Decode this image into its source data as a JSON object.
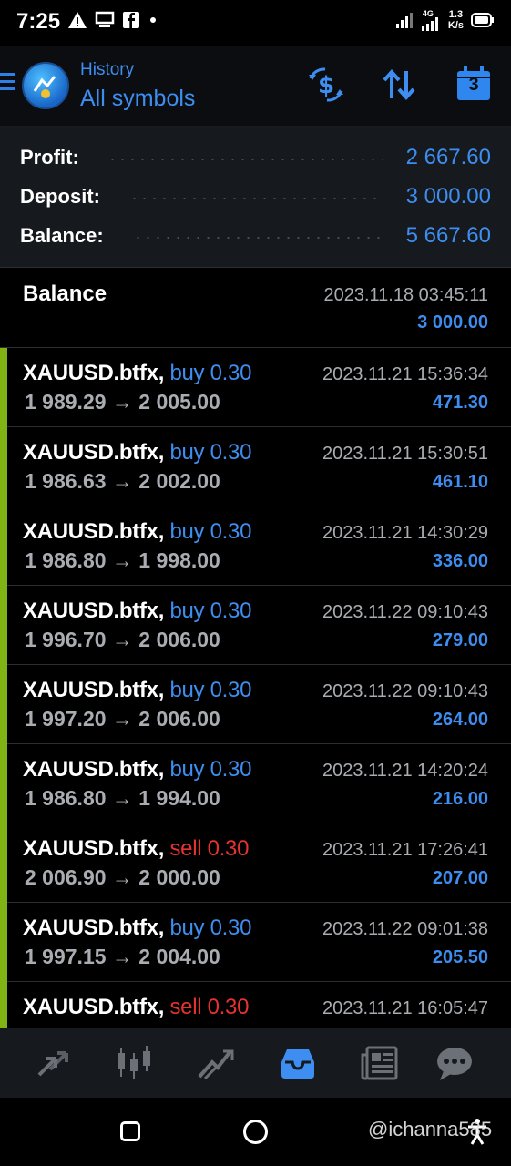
{
  "status_bar": {
    "time": "7:25",
    "network": "4G",
    "speed_value": "1.3",
    "speed_unit": "K/s",
    "icons": [
      "warning-icon",
      "device-icon",
      "facebook-icon",
      "dot-icon",
      "signal-icon",
      "signal-icon-2",
      "battery-icon"
    ]
  },
  "toolbar": {
    "subtitle": "History",
    "title": "All symbols",
    "calendar_day": "3",
    "icons": [
      "menu-icon",
      "dollar-swap-icon",
      "sort-icon",
      "calendar-icon"
    ]
  },
  "summary": [
    {
      "label": "Profit:",
      "value": "2 667.60"
    },
    {
      "label": "Deposit:",
      "value": "3 000.00"
    },
    {
      "label": "Balance:",
      "value": "5 667.60"
    }
  ],
  "balance_entry": {
    "title": "Balance",
    "date": "2023.11.18 03:45:11",
    "amount": "3 000.00"
  },
  "trades": [
    {
      "symbol": "XAUUSD.btfx,",
      "side": "buy 0.30",
      "type": "buy",
      "prices": "1 989.29 → 2 005.00",
      "date": "2023.11.21 15:36:34",
      "profit": "471.30"
    },
    {
      "symbol": "XAUUSD.btfx,",
      "side": "buy 0.30",
      "type": "buy",
      "prices": "1 986.63 → 2 002.00",
      "date": "2023.11.21 15:30:51",
      "profit": "461.10"
    },
    {
      "symbol": "XAUUSD.btfx,",
      "side": "buy 0.30",
      "type": "buy",
      "prices": "1 986.80 → 1 998.00",
      "date": "2023.11.21 14:30:29",
      "profit": "336.00"
    },
    {
      "symbol": "XAUUSD.btfx,",
      "side": "buy 0.30",
      "type": "buy",
      "prices": "1 996.70 → 2 006.00",
      "date": "2023.11.22 09:10:43",
      "profit": "279.00"
    },
    {
      "symbol": "XAUUSD.btfx,",
      "side": "buy 0.30",
      "type": "buy",
      "prices": "1 997.20 → 2 006.00",
      "date": "2023.11.22 09:10:43",
      "profit": "264.00"
    },
    {
      "symbol": "XAUUSD.btfx,",
      "side": "buy 0.30",
      "type": "buy",
      "prices": "1 986.80 → 1 994.00",
      "date": "2023.11.21 14:20:24",
      "profit": "216.00"
    },
    {
      "symbol": "XAUUSD.btfx,",
      "side": "sell 0.30",
      "type": "sell",
      "prices": "2 006.90 → 2 000.00",
      "date": "2023.11.21 17:26:41",
      "profit": "207.00"
    },
    {
      "symbol": "XAUUSD.btfx,",
      "side": "buy 0.30",
      "type": "buy",
      "prices": "1 997.15 → 2 004.00",
      "date": "2023.11.22 09:01:38",
      "profit": "205.50"
    },
    {
      "symbol": "XAUUSD.btfx,",
      "side": "sell 0.30",
      "type": "sell",
      "prices": "",
      "date": "2023.11.21 16:05:47",
      "profit": ""
    }
  ],
  "bottom_nav": [
    {
      "icon": "quotes-icon"
    },
    {
      "icon": "chart-icon"
    },
    {
      "icon": "trade-icon"
    },
    {
      "icon": "history-icon",
      "active": true
    },
    {
      "icon": "news-icon"
    },
    {
      "icon": "chat-icon"
    }
  ],
  "watermark": "@ichanna585",
  "colors": {
    "accent": "#3d8ef0",
    "sell": "#e7332e",
    "trade_bar": "#7fb414",
    "summary_bg": "#16191d",
    "toolbar_bg": "#0b0d10"
  }
}
